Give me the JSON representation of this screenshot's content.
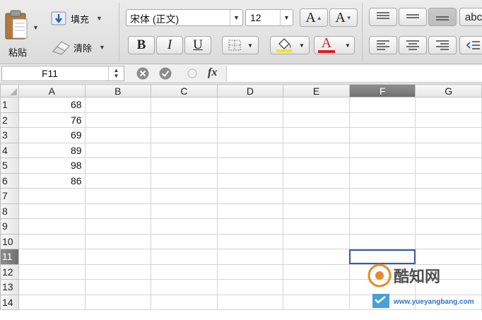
{
  "ribbon": {
    "paste_label": "粘贴",
    "fill_label": "填充",
    "clear_label": "清除",
    "font_name": "宋体 (正文)",
    "font_size": "12",
    "bold": "B",
    "italic": "I",
    "underline": "U",
    "font_color_glyph": "A",
    "increase_font_glyph": "A",
    "decrease_font_glyph": "A",
    "abc_label": "abc",
    "font_color_accent": "#d0202a",
    "highlight_accent": "#f5e51b"
  },
  "formula_bar": {
    "cell_reference": "F11",
    "fx_label": "fx",
    "formula_value": ""
  },
  "sheet": {
    "columns": [
      "A",
      "B",
      "C",
      "D",
      "E",
      "F",
      "G"
    ],
    "rows": [
      "1",
      "2",
      "3",
      "4",
      "5",
      "6",
      "7",
      "8",
      "9",
      "10",
      "11",
      "12",
      "13",
      "14"
    ],
    "selected_cell": "F11",
    "values": {
      "A1": "68",
      "A2": "76",
      "A3": "69",
      "A4": "89",
      "A5": "98",
      "A6": "86"
    }
  },
  "watermark": {
    "brand": "酷知网",
    "site": "www.yueyangbang.com"
  }
}
